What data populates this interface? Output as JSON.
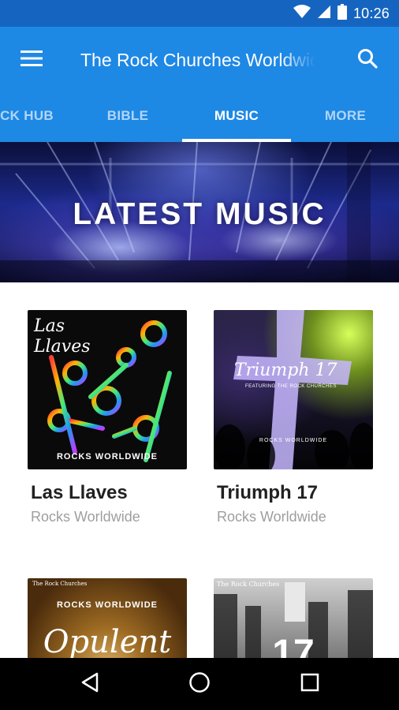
{
  "status_bar": {
    "time": "10:26",
    "icons": [
      "wifi-icon",
      "signal-icon",
      "battery-icon"
    ]
  },
  "app_bar": {
    "title": "The Rock Churches Worldwide",
    "menu_icon": "hamburger-menu-icon",
    "search_icon": "search-icon",
    "color": "#1e88e5"
  },
  "tabs": [
    {
      "label": "ROCK HUB",
      "active": false
    },
    {
      "label": "BIBLE",
      "active": false
    },
    {
      "label": "MUSIC",
      "active": true
    },
    {
      "label": "MORE",
      "active": false
    }
  ],
  "hero": {
    "title": "LATEST MUSIC"
  },
  "albums": [
    {
      "title": "Las Llaves",
      "artist": "Rocks Worldwide",
      "cover_text": "Las Llaves",
      "cover_footer": "ROCKS WORLDWIDE"
    },
    {
      "title": "Triumph 17",
      "artist": "Rocks Worldwide",
      "cover_text": "Triumph 17",
      "cover_subtitle": "FEATURING THE ROCK CHURCHES",
      "cover_footer": "ROCKS WORLDWIDE"
    },
    {
      "cover_header": "ROCKS WORLDWIDE",
      "cover_small": "The Rock Churches",
      "cover_text": "Opulent"
    },
    {
      "cover_small": "The Rock Churches",
      "cover_text": "17"
    }
  ],
  "nav_bar": {
    "icons": [
      "back-icon",
      "home-icon",
      "recents-icon"
    ]
  }
}
